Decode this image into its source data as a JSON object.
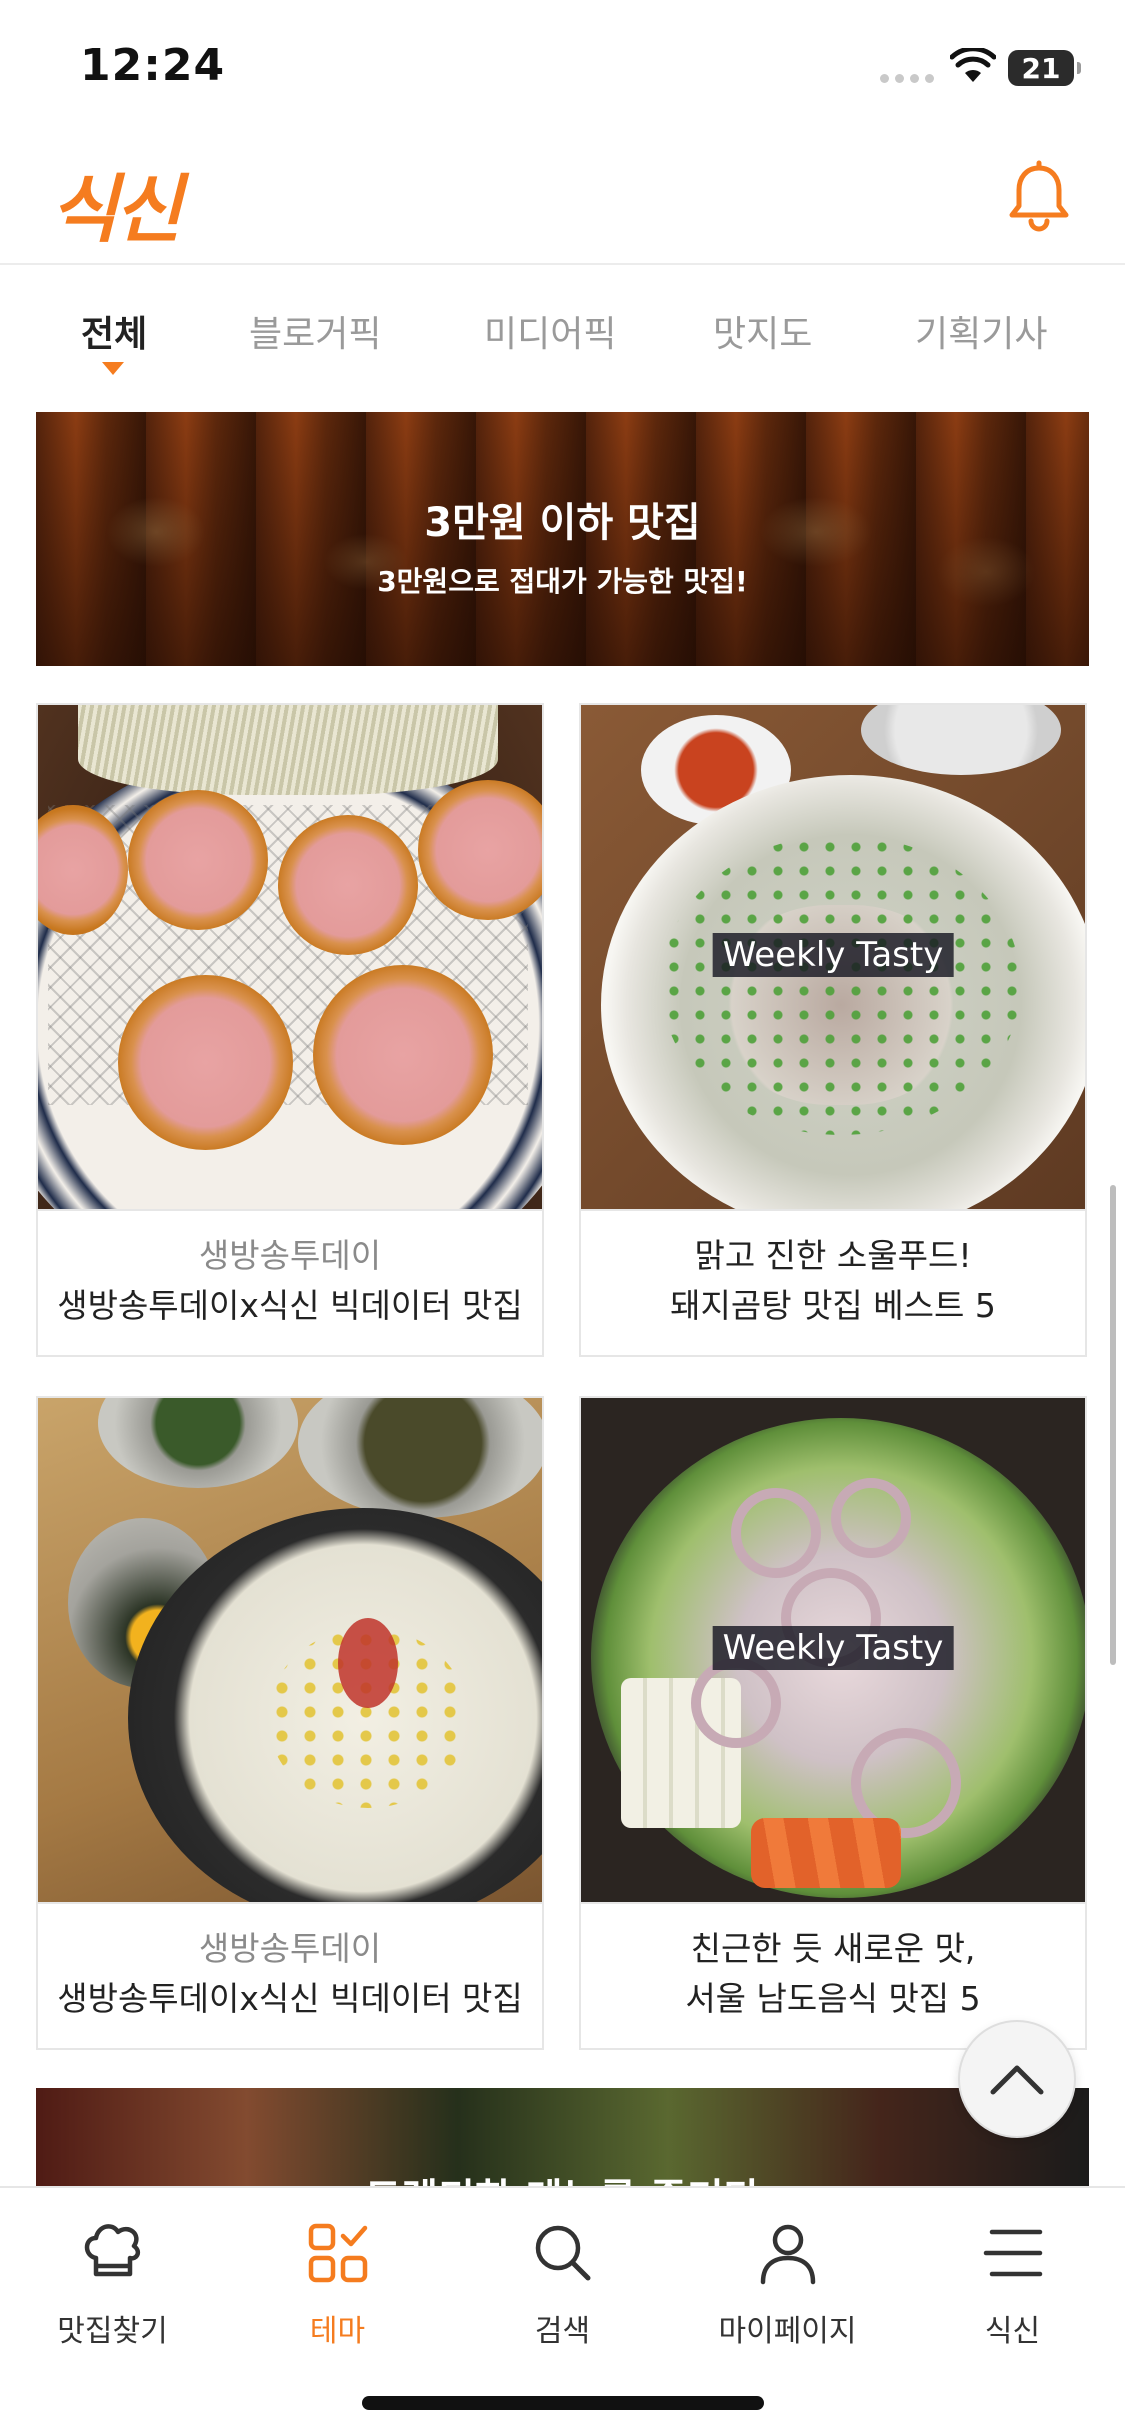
{
  "status_bar": {
    "time": "12:24",
    "battery": "21"
  },
  "header": {
    "logo": "식신",
    "bell_icon": "bell-icon"
  },
  "tabs": [
    {
      "label": "전체",
      "active": true
    },
    {
      "label": "블로거픽",
      "active": false
    },
    {
      "label": "미디어픽",
      "active": false
    },
    {
      "label": "맛지도",
      "active": false
    },
    {
      "label": "기획기사",
      "active": false
    }
  ],
  "banner": {
    "title": "3만원 이하 맛집",
    "subtitle": "3만원으로 접대가 가능한 맛집!"
  },
  "cards": [
    {
      "line1": "생방송투데이",
      "line2": "생방송투데이x식신 빅데이터 맛집",
      "badge": ""
    },
    {
      "line1": "맑고 진한 소울푸드!",
      "line2": "돼지곰탕 맛집 베스트 5",
      "badge": "Weekly Tasty"
    },
    {
      "line1": "생방송투데이",
      "line2": "생방송투데이x식신 빅데이터 맛집",
      "badge": ""
    },
    {
      "line1": "친근한 듯 새로운 맛,",
      "line2": "서울 남도음식 맛집 5",
      "badge": "Weekly Tasty"
    }
  ],
  "bottom_banner": {
    "title": "트렌디한 메뉴를 즐기다"
  },
  "bottom_nav": [
    {
      "label": "맛집찾기",
      "icon": "chef-hat-icon",
      "active": false
    },
    {
      "label": "테마",
      "icon": "theme-grid-icon",
      "active": true
    },
    {
      "label": "검색",
      "icon": "search-icon",
      "active": false
    },
    {
      "label": "마이페이지",
      "icon": "person-icon",
      "active": false
    },
    {
      "label": "식신",
      "icon": "menu-icon",
      "active": false
    }
  ],
  "colors": {
    "accent": "#f57c1f",
    "text": "#222222",
    "muted": "#9a9a9a"
  }
}
